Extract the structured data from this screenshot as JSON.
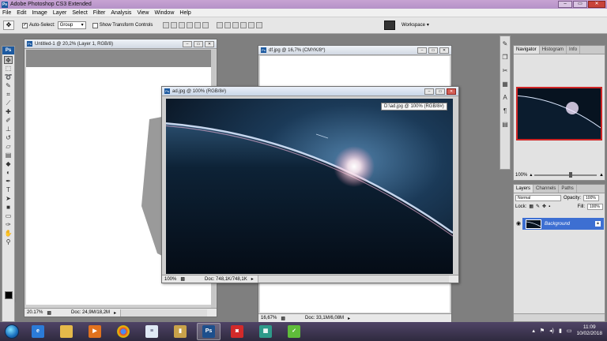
{
  "app": {
    "title": "Adobe Photoshop CS3 Extended",
    "icon": "ps-icon",
    "window_controls": [
      "minimize",
      "restore",
      "close"
    ]
  },
  "menu": [
    "File",
    "Edit",
    "Image",
    "Layer",
    "Select",
    "Filter",
    "Analysis",
    "View",
    "Window",
    "Help"
  ],
  "options_bar": {
    "auto_select_label": "Auto-Select:",
    "auto_select_checked": true,
    "auto_select_value": "Group",
    "show_transform_label": "Show Transform Controls",
    "show_transform_checked": false,
    "workspace_label": "Workspace"
  },
  "toolbox": {
    "badge": "Ps",
    "tools": [
      "move-tool",
      "marquee-tool",
      "lasso-tool",
      "quick-select-tool",
      "crop-tool",
      "slice-tool",
      "healing-tool",
      "brush-tool",
      "clone-stamp-tool",
      "history-brush-tool",
      "eraser-tool",
      "gradient-tool",
      "blur-tool",
      "dodge-tool",
      "pen-tool",
      "type-tool",
      "path-select-tool",
      "shape-tool",
      "notes-tool",
      "eyedropper-tool",
      "hand-tool",
      "zoom-tool"
    ],
    "foreground_color": "#000000",
    "background_color": "#ffffff"
  },
  "documents": {
    "untitled": {
      "title": "Untitled-1 @ 20,2% (Layer 1, RGB/8)",
      "zoom": "20.17%",
      "doc_info": "Doc: 24,9M/18,2M"
    },
    "df": {
      "title": "df.jpg @ 16,7% (CMYK/8*)",
      "zoom": "16,67%",
      "doc_info": "Doc: 33,1M/6,08M"
    },
    "ad": {
      "title": "ad.jpg @ 100% (RGB/8#)",
      "tooltip": "D:\\ad.jpg @ 100% (RGB/8#)",
      "zoom": "100%",
      "doc_info": "Doc: 748,1K/748,1K"
    }
  },
  "navigator": {
    "tabs": [
      "Navigator",
      "Histogram",
      "Info"
    ],
    "active_tab": "Navigator",
    "zoom": "100%",
    "slider_fraction": 0.55
  },
  "layers_panel": {
    "tabs": [
      "Layers",
      "Channels",
      "Paths"
    ],
    "active_tab": "Layers",
    "blend_mode": "Normal",
    "opacity_label": "Opacity:",
    "opacity_value": "100%",
    "lock_label": "Lock:",
    "fill_label": "Fill:",
    "fill_value": "100%",
    "layers": [
      {
        "name": "Background",
        "visible": true,
        "locked": true,
        "selected": true
      }
    ]
  },
  "taskbar": {
    "apps": [
      "internet-explorer-icon",
      "folder-icon",
      "media-player-icon",
      "chrome-icon",
      "document-icon",
      "usb-drive-icon",
      "photoshop-icon",
      "camera-app-icon",
      "image-viewer-icon",
      "green-app-icon"
    ],
    "active_app": "photoshop-icon",
    "time": "11:09",
    "date": "10/02/2018"
  },
  "colors": {
    "title_bar": "#c0a0d0",
    "workspace_bg": "#7f7f7f",
    "selected_layer": "#3d6fd2",
    "nav_view_box": "#d02525"
  }
}
